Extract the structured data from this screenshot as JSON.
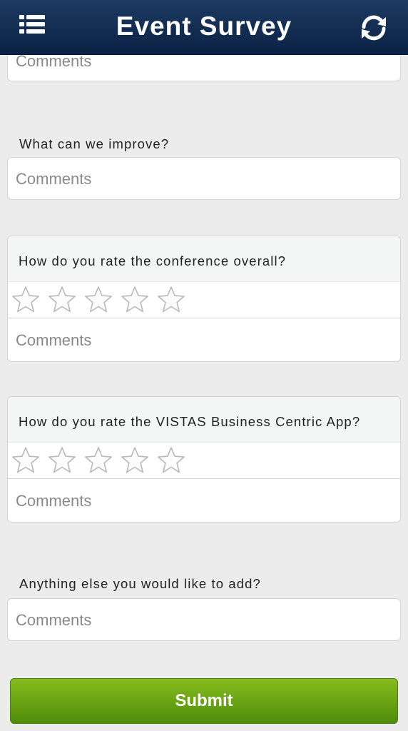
{
  "header": {
    "title": "Event Survey",
    "menu_icon": "list-menu-icon",
    "refresh_icon": "refresh-icon"
  },
  "questions": [
    {
      "comment_placeholder": "Comments"
    },
    {
      "label": "What can we improve?",
      "comment_placeholder": "Comments"
    },
    {
      "label": "How do you rate the conference overall?",
      "rating": 0,
      "max_rating": 5,
      "comment_placeholder": "Comments"
    },
    {
      "label": "How do you rate the VISTAS Business Centric App?",
      "rating": 0,
      "max_rating": 5,
      "comment_placeholder": "Comments"
    },
    {
      "label": "Anything else you would like to add?",
      "comment_placeholder": "Comments"
    }
  ],
  "submit_label": "Submit",
  "colors": {
    "header_bg": "#0f2a4e",
    "submit_bg": "#6aa815",
    "page_bg": "#ececec"
  }
}
